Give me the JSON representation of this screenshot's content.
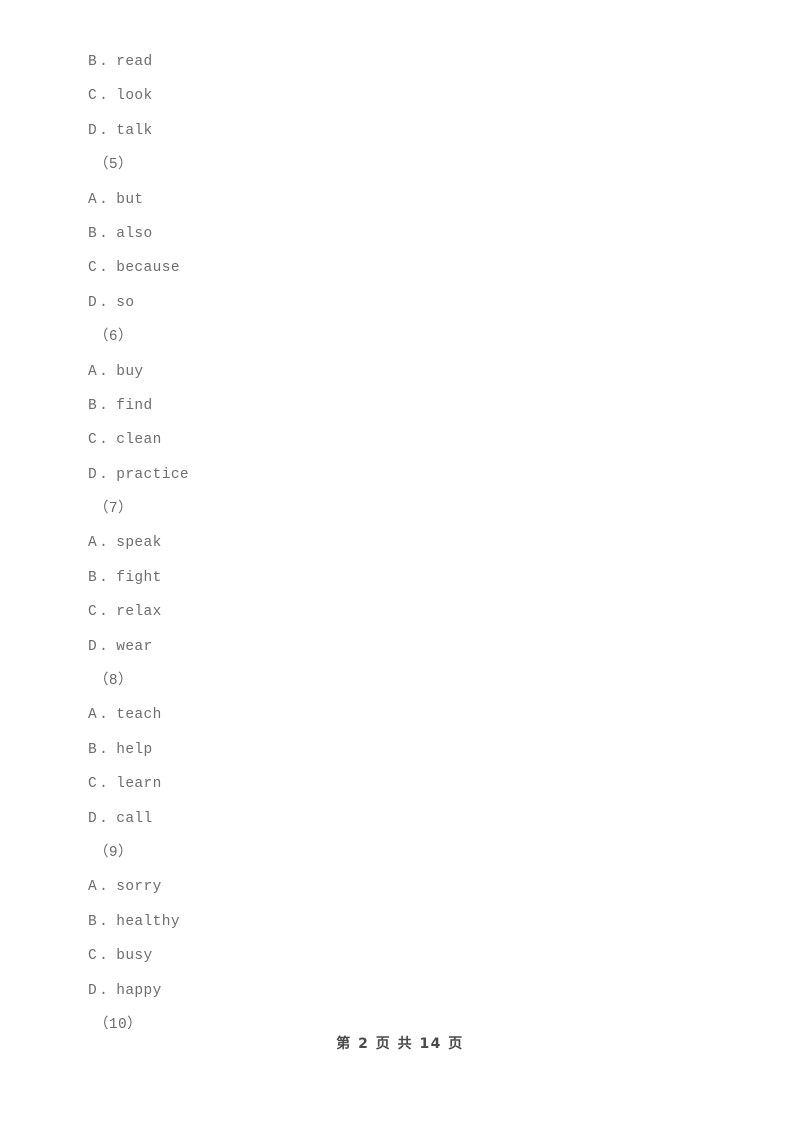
{
  "document": {
    "page_label": "第 2 页 共 14 页",
    "current_page": "2",
    "total_pages": "14",
    "text_color": "#6e6e6e",
    "footer_color": "#4a4a4a",
    "background_color": "#ffffff"
  },
  "blocks": [
    {
      "kind": "option",
      "letter": "B",
      "separator": ".",
      "text": "read"
    },
    {
      "kind": "option",
      "letter": "C",
      "separator": ".",
      "text": "look"
    },
    {
      "kind": "option",
      "letter": "D",
      "separator": ".",
      "text": "talk"
    },
    {
      "kind": "question",
      "label": "（5）"
    },
    {
      "kind": "option",
      "letter": "A",
      "separator": ".",
      "text": "but"
    },
    {
      "kind": "option",
      "letter": "B",
      "separator": ".",
      "text": "also"
    },
    {
      "kind": "option",
      "letter": "C",
      "separator": ".",
      "text": "because"
    },
    {
      "kind": "option",
      "letter": "D",
      "separator": ".",
      "text": "so"
    },
    {
      "kind": "question",
      "label": "（6）"
    },
    {
      "kind": "option",
      "letter": "A",
      "separator": ".",
      "text": "buy"
    },
    {
      "kind": "option",
      "letter": "B",
      "separator": ".",
      "text": "find"
    },
    {
      "kind": "option",
      "letter": "C",
      "separator": ".",
      "text": "clean"
    },
    {
      "kind": "option",
      "letter": "D",
      "separator": ".",
      "text": "practice"
    },
    {
      "kind": "question",
      "label": "（7）"
    },
    {
      "kind": "option",
      "letter": "A",
      "separator": ".",
      "text": "speak"
    },
    {
      "kind": "option",
      "letter": "B",
      "separator": ".",
      "text": "fight"
    },
    {
      "kind": "option",
      "letter": "C",
      "separator": ".",
      "text": "relax"
    },
    {
      "kind": "option",
      "letter": "D",
      "separator": ".",
      "text": "wear"
    },
    {
      "kind": "question",
      "label": "（8）"
    },
    {
      "kind": "option",
      "letter": "A",
      "separator": ".",
      "text": "teach"
    },
    {
      "kind": "option",
      "letter": "B",
      "separator": ".",
      "text": "help"
    },
    {
      "kind": "option",
      "letter": "C",
      "separator": ".",
      "text": "learn"
    },
    {
      "kind": "option",
      "letter": "D",
      "separator": ".",
      "text": "call"
    },
    {
      "kind": "question",
      "label": "（9）"
    },
    {
      "kind": "option",
      "letter": "A",
      "separator": ".",
      "text": "sorry"
    },
    {
      "kind": "option",
      "letter": "B",
      "separator": ".",
      "text": "healthy"
    },
    {
      "kind": "option",
      "letter": "C",
      "separator": ".",
      "text": "busy"
    },
    {
      "kind": "option",
      "letter": "D",
      "separator": ".",
      "text": "happy"
    },
    {
      "kind": "question",
      "label": "（10）"
    }
  ]
}
